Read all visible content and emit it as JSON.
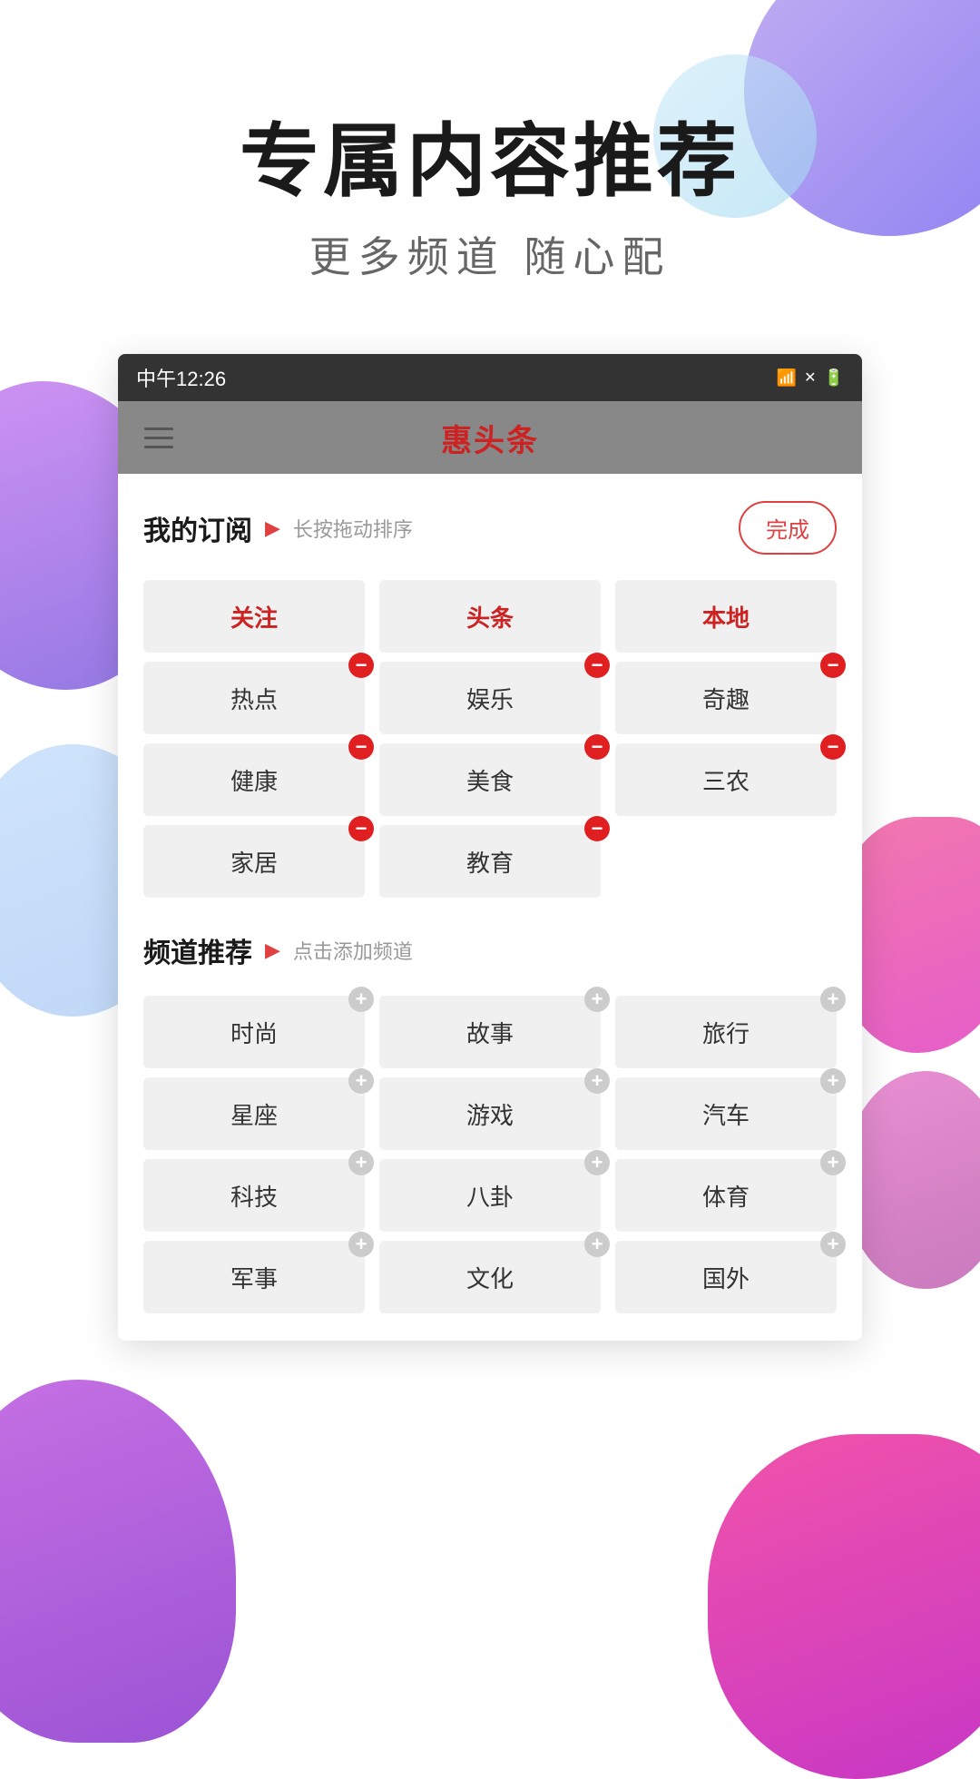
{
  "background": {
    "blobs": [
      "top-right",
      "left-mid",
      "right-mid",
      "bottom-left",
      "bottom-right"
    ]
  },
  "header": {
    "main_title": "专属内容推荐",
    "sub_title": "更多频道 随心配"
  },
  "phone": {
    "status_bar": {
      "time": "中午12:26",
      "icons": "WiFi | X | Battery"
    },
    "app_header": {
      "logo": "惠头条",
      "menu_hint": "menu"
    },
    "my_subscriptions": {
      "title": "我的订阅",
      "hint": "长按拖动排序",
      "done_button": "完成",
      "channels_row1": [
        {
          "label": "关注",
          "removable": false,
          "active": true
        },
        {
          "label": "头条",
          "removable": false,
          "active": true
        },
        {
          "label": "本地",
          "removable": false,
          "active": true
        }
      ],
      "channels_row2": [
        {
          "label": "热点",
          "removable": true
        },
        {
          "label": "娱乐",
          "removable": true
        },
        {
          "label": "奇趣",
          "removable": true
        }
      ],
      "channels_row3": [
        {
          "label": "健康",
          "removable": true
        },
        {
          "label": "美食",
          "removable": true
        },
        {
          "label": "三农",
          "removable": true
        }
      ],
      "channels_row4": [
        {
          "label": "家居",
          "removable": true
        },
        {
          "label": "教育",
          "removable": true
        }
      ]
    },
    "channel_recommend": {
      "title": "频道推荐",
      "hint": "点击添加频道",
      "channels_row1": [
        {
          "label": "时尚",
          "addable": true
        },
        {
          "label": "故事",
          "addable": true
        },
        {
          "label": "旅行",
          "addable": true
        }
      ],
      "channels_row2": [
        {
          "label": "星座",
          "addable": true
        },
        {
          "label": "游戏",
          "addable": true
        },
        {
          "label": "汽车",
          "addable": true
        }
      ],
      "channels_row3": [
        {
          "label": "科技",
          "addable": true
        },
        {
          "label": "八卦",
          "addable": true
        },
        {
          "label": "体育",
          "addable": true
        }
      ],
      "channels_row4": [
        {
          "label": "军事",
          "addable": true
        },
        {
          "label": "文化",
          "addable": true
        },
        {
          "label": "国外",
          "addable": true
        }
      ]
    }
  }
}
